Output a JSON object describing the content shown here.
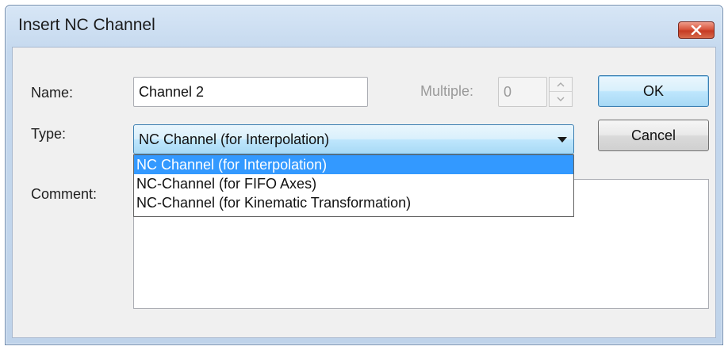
{
  "window": {
    "title": "Insert NC Channel",
    "close_icon": "close-icon"
  },
  "form": {
    "name_label": "Name:",
    "name_value": "Channel 2",
    "multiple_label": "Multiple:",
    "multiple_value": "0",
    "type_label": "Type:",
    "type_selected": "NC Channel (for Interpolation)",
    "type_options": [
      "NC Channel (for Interpolation)",
      "NC-Channel (for FIFO Axes)",
      "NC-Channel (for Kinematic Transformation)"
    ],
    "comment_label": "Comment:",
    "comment_value": ""
  },
  "buttons": {
    "ok_label": "OK",
    "cancel_label": "Cancel"
  },
  "colors": {
    "selection": "#3399ff",
    "close_button": "#c63a24",
    "title_bar": "#c4d8ee"
  }
}
